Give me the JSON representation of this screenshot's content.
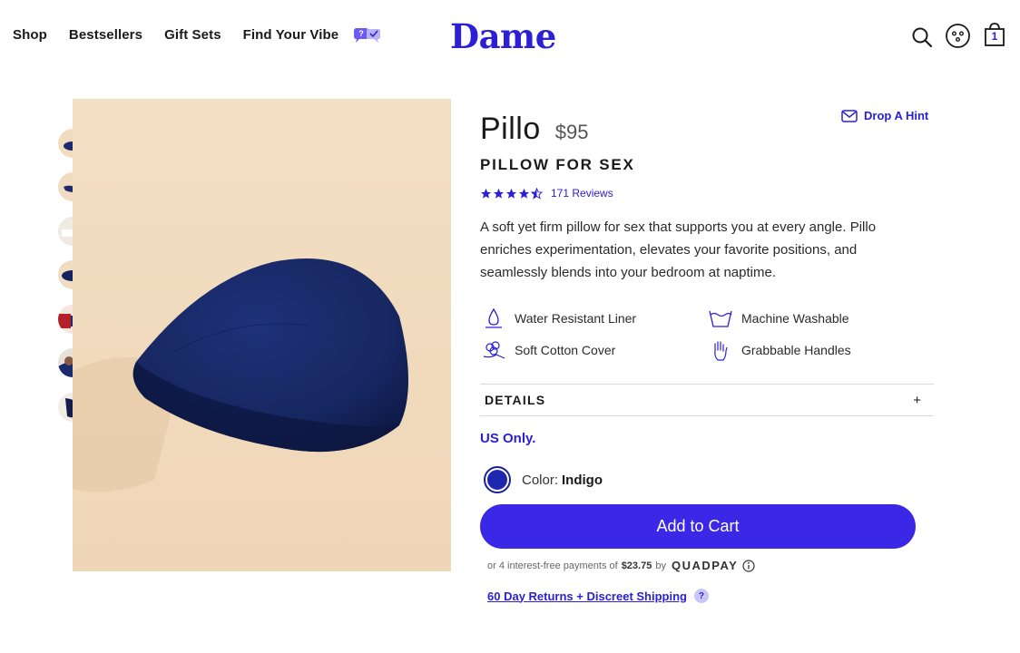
{
  "nav": {
    "links": [
      "Shop",
      "Bestsellers",
      "Gift Sets",
      "Find Your Vibe"
    ],
    "logo": "Dame",
    "cart_count": "1",
    "vibe_badge": "?",
    "icons": [
      "search-icon",
      "account-icon",
      "cart-icon",
      "vibe-chat-icon"
    ]
  },
  "product": {
    "name": "Pillo",
    "price": "$95",
    "subtitle": "PILLOW FOR SEX",
    "rating": 4.5,
    "review_count": "171 Reviews",
    "description": "A soft yet firm pillow for sex that supports you at every angle. Pillo enriches experimentation, elevates your favorite positions, and seamlessly blends into your bedroom at naptime.",
    "drop_hint": "Drop A Hint",
    "features": [
      {
        "label": "Water Resistant Liner",
        "icon": "water-drop-icon"
      },
      {
        "label": "Machine Washable",
        "icon": "wash-basin-icon"
      },
      {
        "label": "Soft Cotton Cover",
        "icon": "cotton-flower-icon"
      },
      {
        "label": "Grabbable Handles",
        "icon": "hand-icon"
      }
    ],
    "details_label": "DETAILS",
    "details_toggle": "+",
    "availability": "US Only.",
    "color_label": "Color:",
    "color_value": "Indigo",
    "add_to_cart": "Add to Cart",
    "installments": {
      "prefix": "or 4 interest-free payments of",
      "amount": "$23.75",
      "by": "by",
      "provider": "QUADPAY"
    },
    "returns": "60 Day Returns + Discreet Shipping",
    "returns_help": "?"
  },
  "gallery": {
    "thumbnail_count": 7
  },
  "colors": {
    "brand": "#2b20d6",
    "button": "#3a28e6",
    "swatch": "#1e27b0",
    "image_background": "#f0dcc0",
    "pillow": "#1a2a6c"
  }
}
